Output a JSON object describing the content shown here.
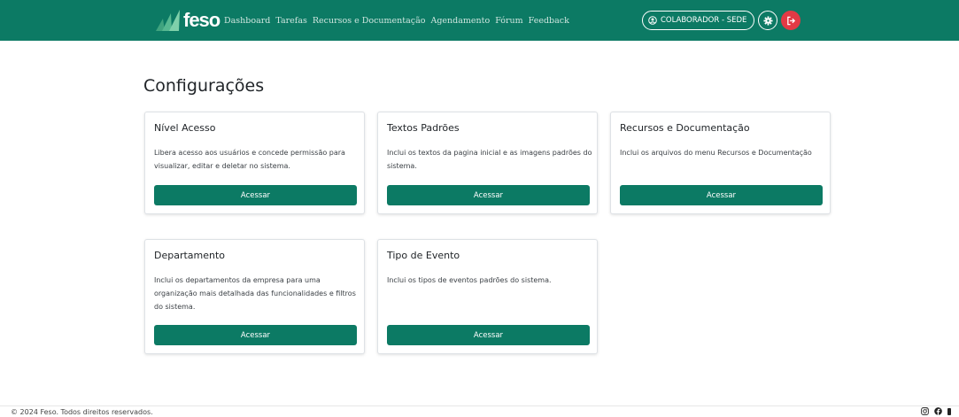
{
  "header": {
    "brand": "feso",
    "nav": [
      "Dashboard",
      "Tarefas",
      "Recursos e Documentação",
      "Agendamento",
      "Fórum",
      "Feedback"
    ],
    "user_label": "COLABORADOR - SEDE"
  },
  "main": {
    "title": "Configurações",
    "cards": [
      {
        "title": "Nível Acesso",
        "text": "Libera acesso aos usuários e concede permissão para visualizar, editar e deletar no sistema.",
        "button": "Acessar"
      },
      {
        "title": "Textos Padrões",
        "text": "Inclui os textos da pagina inicial e as imagens padrões do sistema.",
        "button": "Acessar"
      },
      {
        "title": "Recursos e Documentação",
        "text": "Inclui os arquivos do menu Recursos e Documentação",
        "button": "Acessar"
      },
      {
        "title": "Departamento",
        "text": "Inclui os departamentos da empresa para uma organização mais detalhada das funcionalidades e filtros do sistema.",
        "button": "Acessar"
      },
      {
        "title": "Tipo de Evento",
        "text": "Inclui os tipos de eventos padrões do sistema.",
        "button": "Acessar"
      }
    ]
  },
  "footer": {
    "copyright": "© 2024 Feso. Todos direitos reservados."
  },
  "colors": {
    "primary": "#0c7a64",
    "danger": "#e23a45"
  },
  "icons": [
    "user-circle-icon",
    "gear-icon",
    "logout-icon",
    "instagram-icon",
    "facebook-icon"
  ]
}
